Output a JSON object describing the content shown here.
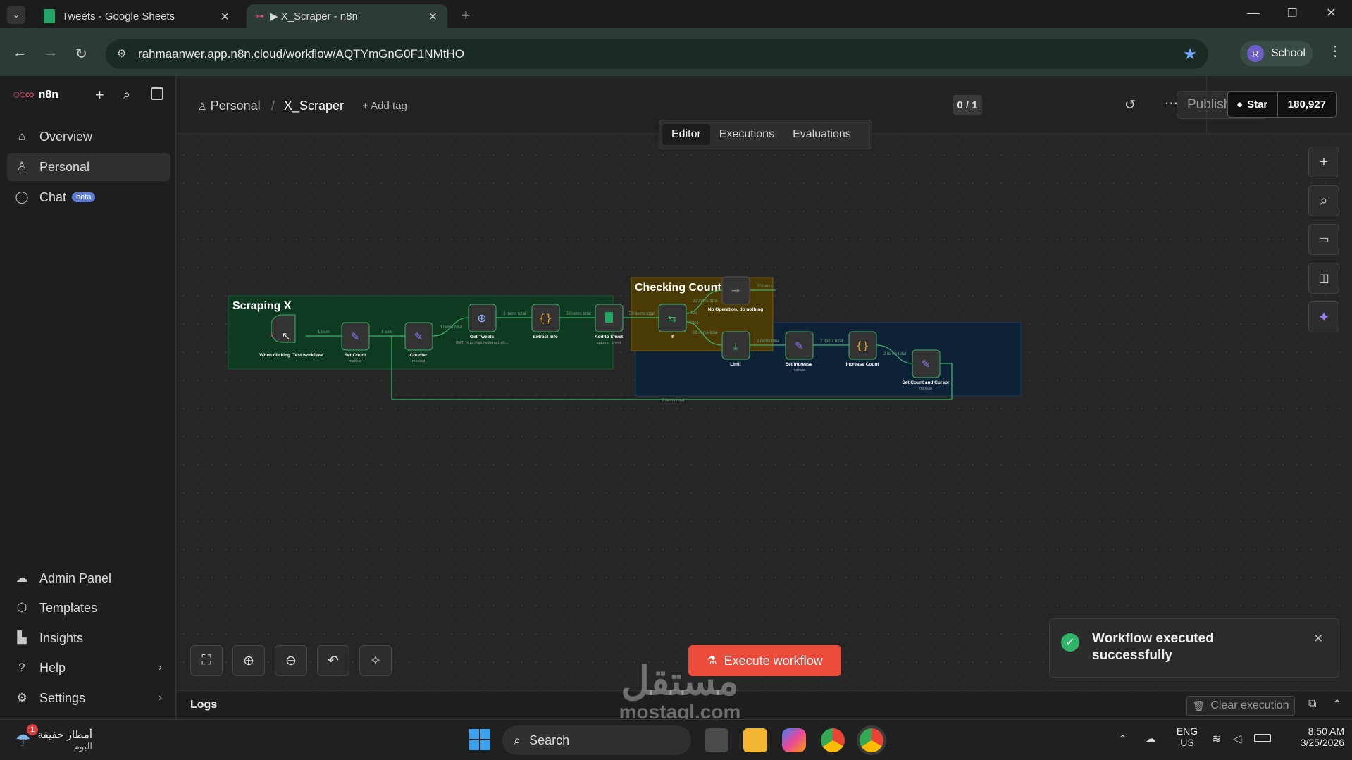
{
  "browser": {
    "tabs": [
      {
        "label": "Tweets - Google Sheets"
      },
      {
        "label": "▶ X_Scraper - n8n"
      }
    ],
    "url": "rahmaanwer.app.n8n.cloud/workflow/AQTYmGnG0F1NMtHO",
    "profile_label": "School",
    "profile_initial": "R"
  },
  "sidebar": {
    "brand": "n8n",
    "top_items": [
      {
        "label": "Overview",
        "icon": "home-icon"
      },
      {
        "label": "Personal",
        "icon": "user-icon"
      },
      {
        "label": "Chat",
        "icon": "chat-icon",
        "badge": "beta"
      }
    ],
    "bottom_items": [
      {
        "label": "Admin Panel",
        "icon": "cloud-icon"
      },
      {
        "label": "Templates",
        "icon": "box-icon"
      },
      {
        "label": "Insights",
        "icon": "chart-icon"
      },
      {
        "label": "Help",
        "icon": "help-icon"
      },
      {
        "label": "Settings",
        "icon": "gear-icon"
      }
    ]
  },
  "header": {
    "project": "Personal",
    "separator": "/",
    "workflow_name": "X_Scraper",
    "add_tag": "+ Add tag",
    "counter": "0 / 1",
    "publish": "Publish",
    "github_star": "Star",
    "github_count": "180,927"
  },
  "view_tabs": [
    {
      "label": "Editor"
    },
    {
      "label": "Executions"
    },
    {
      "label": "Evaluations"
    }
  ],
  "groups": [
    {
      "title": "Scraping X",
      "color": "#0f3a22"
    },
    {
      "title": "Checking Count",
      "color": "#4a3a06"
    }
  ],
  "nodes": [
    {
      "name": "When clicking 'Test workflow'",
      "sub": ""
    },
    {
      "name": "Set Count",
      "sub": "manual"
    },
    {
      "name": "Counter",
      "sub": "manual"
    },
    {
      "name": "Get Tweets",
      "sub": "GET: https://api.twitterapi.io/t..."
    },
    {
      "name": "Extract Info",
      "sub": ""
    },
    {
      "name": "Add to Sheet",
      "sub": "append: sheet"
    },
    {
      "name": "If",
      "sub": ""
    },
    {
      "name": "No Operation, do nothing",
      "sub": ""
    },
    {
      "name": "Limit",
      "sub": ""
    },
    {
      "name": "Set Increase",
      "sub": "manual"
    },
    {
      "name": "Increase Count",
      "sub": ""
    },
    {
      "name": "Set Count and Cursor",
      "sub": "manual"
    }
  ],
  "edge_labels": [
    "1 item",
    "1 item",
    "3 items total",
    "3 items total",
    "59 items total",
    "59 items total",
    "20 items total",
    "39 items total",
    "20 items",
    "2 items total",
    "2 items total",
    "2 items total",
    "2 items total"
  ],
  "branch_labels": [
    "true",
    "false"
  ],
  "canvas": {
    "execute_label": "Execute workflow"
  },
  "toast": {
    "message": "Workflow executed successfully"
  },
  "logs": {
    "title": "Logs",
    "clear": "Clear execution"
  },
  "taskbar": {
    "weather_text": "أمطار خفيفة",
    "weather_sub": "اليوم",
    "weather_badge": "1",
    "search": "Search",
    "lang": "ENG",
    "region": "US",
    "time": "8:50 AM",
    "date": "3/25/2026"
  },
  "watermark": {
    "arabic": "مستقل",
    "latin": "mostaql.com"
  }
}
